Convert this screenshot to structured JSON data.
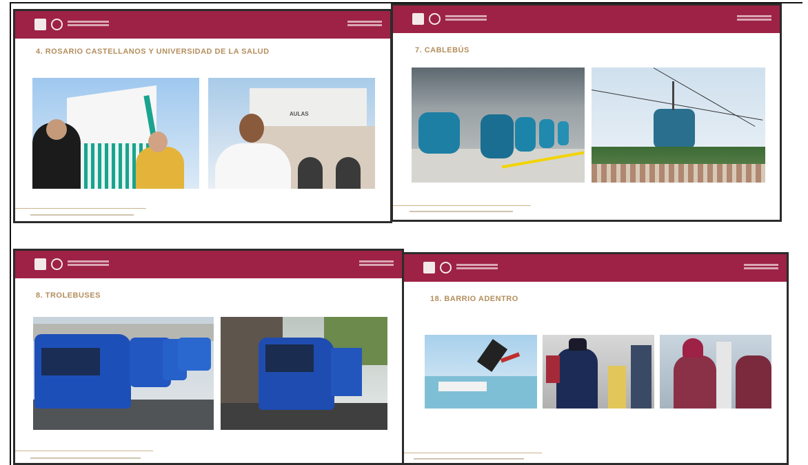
{
  "slides": [
    {
      "title": "4. ROSARIO CASTELLANOS Y UNIVERSIDAD DE LA SALUD",
      "sign_text": "AULAS"
    },
    {
      "title": "7. CABLEBÚS"
    },
    {
      "title": "8. TROLEBUSES"
    },
    {
      "title": "18. BARRIO ADENTRO"
    }
  ],
  "colors": {
    "bar": "#9d2245",
    "title": "#b38e5d"
  }
}
